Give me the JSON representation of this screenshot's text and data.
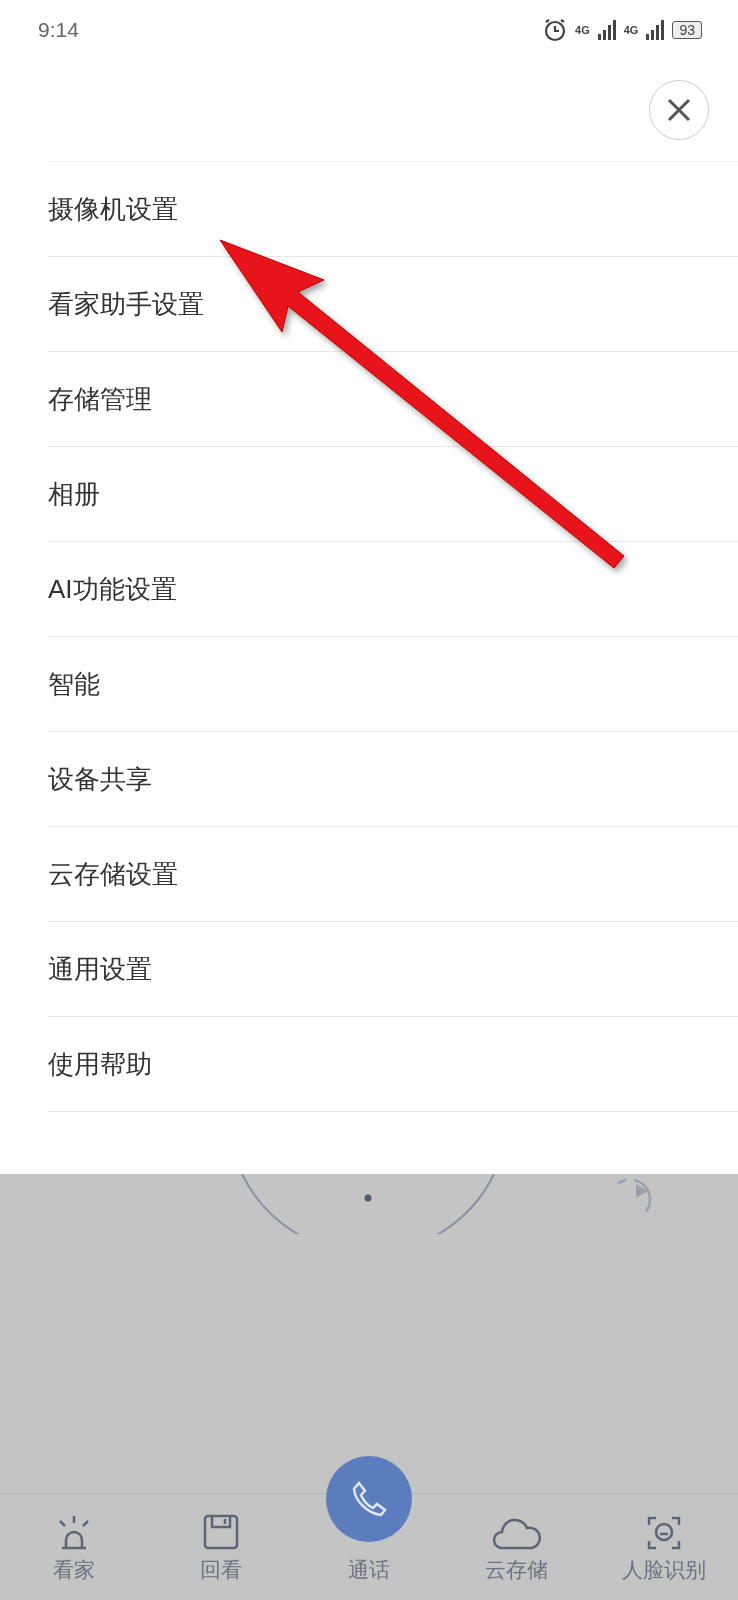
{
  "status_bar": {
    "time": "9:14",
    "network_1": "4G",
    "network_2": "4G",
    "battery": "93"
  },
  "menu": {
    "items": [
      {
        "label": "摄像机设置"
      },
      {
        "label": "看家助手设置"
      },
      {
        "label": "存储管理"
      },
      {
        "label": "相册"
      },
      {
        "label": "AI功能设置"
      },
      {
        "label": "智能"
      },
      {
        "label": "设备共享"
      },
      {
        "label": "云存储设置"
      },
      {
        "label": "通用设置"
      },
      {
        "label": "使用帮助"
      }
    ]
  },
  "bottom_nav": [
    {
      "label": "看家",
      "kind": "alarm"
    },
    {
      "label": "回看",
      "kind": "save"
    },
    {
      "label": "通话",
      "kind": "call"
    },
    {
      "label": "云存储",
      "kind": "cloud"
    },
    {
      "label": "人脸识别",
      "kind": "face"
    }
  ]
}
